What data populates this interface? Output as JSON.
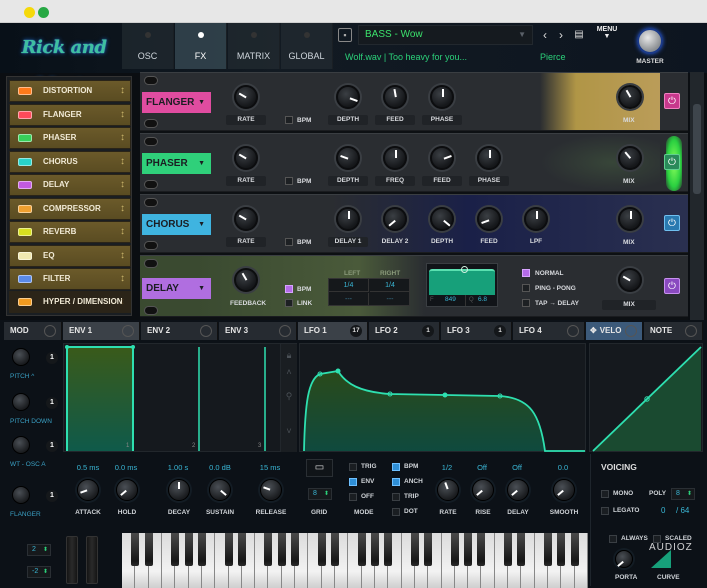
{
  "window": {
    "traffic_lights": {
      "minimize_color": "#f5d90a",
      "maximize_color": "#27a844"
    }
  },
  "header": {
    "logo_text": "Rick and Morty",
    "nav_tabs": [
      {
        "label": "OSC",
        "active": false
      },
      {
        "label": "FX",
        "active": true
      },
      {
        "label": "MATRIX",
        "active": false
      },
      {
        "label": "GLOBAL",
        "active": false
      }
    ],
    "save_icon": "floppy-icon",
    "preset_name": "BASS - Wow",
    "preset_dropdown_icon": "chevron-down-icon",
    "prev_label": "‹",
    "next_label": "›",
    "browser_icon": "browser-window-icon",
    "menu_label": "MENU",
    "preset_info": "Wolf.wav | Too heavy for you...",
    "author": "Pierce",
    "master_label": "MASTER"
  },
  "fx_list": {
    "items": [
      {
        "label": "DISTORTION",
        "color": "#ff7a1a"
      },
      {
        "label": "FLANGER",
        "color": "#ff4a5a"
      },
      {
        "label": "PHASER",
        "color": "#37d05a"
      },
      {
        "label": "CHORUS",
        "color": "#29d3c9"
      },
      {
        "label": "DELAY",
        "color": "#c25ae0"
      },
      {
        "label": "COMPRESSOR",
        "color": "#f0a030"
      },
      {
        "label": "REVERB",
        "color": "#d8e020"
      },
      {
        "label": "EQ",
        "color": "#f0e8b0"
      },
      {
        "label": "FILTER",
        "color": "#5a8ae8"
      },
      {
        "label": "HYPER / DIMENSION",
        "color": "#f09a20"
      }
    ]
  },
  "fx_rack": {
    "flanger": {
      "name": "FLANGER",
      "color": "#e04ca0",
      "knobs": [
        "RATE",
        "DEPTH",
        "FEED",
        "PHASE",
        "MIX"
      ],
      "bpm_label": "BPM",
      "bpm_on": false
    },
    "phaser": {
      "name": "PHASER",
      "color": "#2fd07a",
      "knobs": [
        "RATE",
        "DEPTH",
        "FREQ",
        "FEED",
        "PHASE",
        "MIX"
      ],
      "bpm_label": "BPM",
      "bpm_on": false
    },
    "chorus": {
      "name": "CHORUS",
      "color": "#3fb4e0",
      "knobs": [
        "RATE",
        "DELAY 1",
        "DELAY 2",
        "DEPTH",
        "FEED",
        "LPF",
        "MIX"
      ],
      "bpm_label": "BPM",
      "bpm_on": false
    },
    "delay": {
      "name": "DELAY",
      "color": "#b06ee0",
      "feedback_label": "FEEDBACK",
      "bpm_label": "BPM",
      "bpm_on": true,
      "link_label": "LINK",
      "link_on": false,
      "left_label": "LEFT",
      "right_label": "RIGHT",
      "left_time": "1/4",
      "right_time": "1/4",
      "left_sub": "---",
      "right_sub": "---",
      "filter_f_label": "F",
      "filter_f_value": "849",
      "filter_q_label": "Q",
      "filter_q_value": "6.8",
      "modes": [
        {
          "label": "NORMAL",
          "on": true
        },
        {
          "label": "PING - PONG",
          "on": false
        },
        {
          "label": "TAP → DELAY",
          "on": false
        }
      ],
      "mix_label": "MIX"
    }
  },
  "mod": {
    "tabs": [
      {
        "label": "MOD"
      },
      {
        "label": "ENV 1",
        "active": true
      },
      {
        "label": "ENV 2"
      },
      {
        "label": "ENV 3"
      },
      {
        "label": "LFO 1",
        "badge": "17",
        "active": true
      },
      {
        "label": "LFO 2",
        "badge": "1"
      },
      {
        "label": "LFO 3",
        "badge": "1"
      },
      {
        "label": "LFO 4"
      },
      {
        "label": "VELO",
        "active": true
      },
      {
        "label": "NOTE"
      }
    ],
    "slots": [
      {
        "amount": "1",
        "source": "PITCH ^"
      },
      {
        "amount": "1",
        "source": "PITCH DOWN"
      },
      {
        "amount": "1",
        "source": "WT - OSC A"
      },
      {
        "amount": "1",
        "source": "FLANGER"
      }
    ],
    "env_markers": [
      "1",
      "2",
      "3"
    ],
    "env": {
      "values": [
        "0.5 ms",
        "0.0 ms",
        "1.00 s",
        "0.0 dB",
        "15 ms"
      ],
      "labels": [
        "ATTACK",
        "HOLD",
        "DECAY",
        "SUSTAIN",
        "RELEASE"
      ]
    },
    "lfo": {
      "grid_label": "GRID",
      "grid_value": "8",
      "mode_label": "MODE",
      "mode_options": [
        {
          "label": "TRIG",
          "on": false
        },
        {
          "label": "ENV",
          "on": true
        },
        {
          "label": "OFF",
          "on": false
        }
      ],
      "sync_options": [
        {
          "label": "BPM",
          "on": true
        },
        {
          "label": "ANCH",
          "on": true
        },
        {
          "label": "TRIP",
          "on": false
        },
        {
          "label": "DOT",
          "on": false
        }
      ],
      "values": [
        "1/2",
        "Off",
        "Off",
        "0.0"
      ],
      "labels": [
        "RATE",
        "RISE",
        "DELAY",
        "SMOOTH"
      ]
    },
    "voicing": {
      "title": "VOICING",
      "mono_label": "MONO",
      "poly_label": "POLY",
      "poly_value": "8",
      "legato_label": "LEGATO",
      "voices_used": "0",
      "voices_max": "/ 64",
      "always_label": "ALWAYS",
      "scaled_label": "SCALED",
      "porta_label": "PORTA",
      "curve_label": "CURVE"
    }
  },
  "keyboard": {
    "octave_up": "2",
    "octave_down": "-2"
  },
  "watermark": "AUDIOZ"
}
